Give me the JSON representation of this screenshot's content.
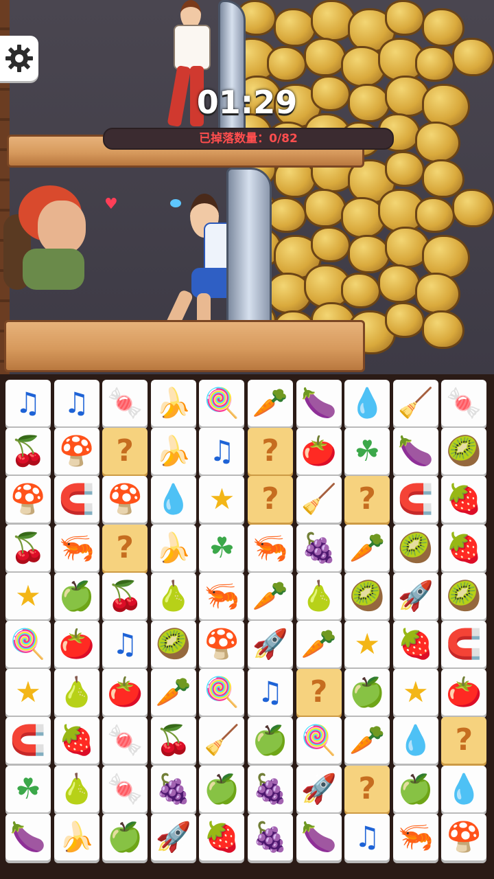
{
  "hud": {
    "timer": "01:29",
    "progress_label": "已掉落数量：0/82",
    "progress_fraction": 0.0,
    "settings_icon": "gear-icon"
  },
  "colors": {
    "accent": "#ff4e4e",
    "tile": "#fdfdfd",
    "mystery": "#f6d27e"
  },
  "grid": {
    "rows": [
      [
        "music",
        "music",
        "candy",
        "banana",
        "lollipop",
        "carrot",
        "eggplant",
        "water",
        "broom",
        "candy"
      ],
      [
        "cherry",
        "mushroom",
        "mystery",
        "banana",
        "music",
        "mystery",
        "tomato",
        "clover",
        "eggplant",
        "kiwi"
      ],
      [
        "mushroom",
        "magnet",
        "red-mushroom",
        "water",
        "star",
        "mystery",
        "broom",
        "mystery",
        "magnet",
        "strawberry"
      ],
      [
        "cherry",
        "shrimp",
        "mystery",
        "banana",
        "clover",
        "shrimp",
        "grapes",
        "carrot",
        "kiwi",
        "strawberry"
      ],
      [
        "star",
        "apple",
        "cherry",
        "pear",
        "shrimp",
        "carrot",
        "pear",
        "kiwi",
        "rocket",
        "kiwi"
      ],
      [
        "lollipop",
        "tomato",
        "music",
        "kiwi",
        "mushroom",
        "rocket",
        "carrot",
        "star",
        "strawberry",
        "magnet"
      ],
      [
        "star",
        "pear",
        "tomato",
        "carrot",
        "lollipop",
        "music",
        "mystery",
        "apple",
        "star",
        "tomato"
      ],
      [
        "magnet",
        "strawberry",
        "candy",
        "cherry",
        "broom",
        "apple",
        "lollipop",
        "carrot",
        "water",
        "mystery"
      ],
      [
        "clover",
        "pear",
        "candy",
        "grapes",
        "apple",
        "grapes",
        "rocket",
        "mystery",
        "apple",
        "water"
      ],
      [
        "eggplant",
        "banana",
        "apple",
        "rocket",
        "strawberry",
        "grapes",
        "eggplant",
        "music",
        "shrimp",
        "mushroom"
      ]
    ],
    "glyphs": {
      "music": "♫",
      "candy": "🍬",
      "banana": "🍌",
      "lollipop": "🍭",
      "carrot": "🥕",
      "eggplant": "🍆",
      "water": "💧",
      "broom": "🧹",
      "cherry": "🍒",
      "mushroom": "🍄",
      "mystery": "?",
      "tomato": "🍅",
      "clover": "☘",
      "kiwi": "🥝",
      "magnet": "🧲",
      "red-mushroom": "🍄",
      "star": "★",
      "strawberry": "🍓",
      "shrimp": "🦐",
      "grapes": "🍇",
      "apple": "🍏",
      "pear": "🍐",
      "rocket": "🚀"
    }
  }
}
